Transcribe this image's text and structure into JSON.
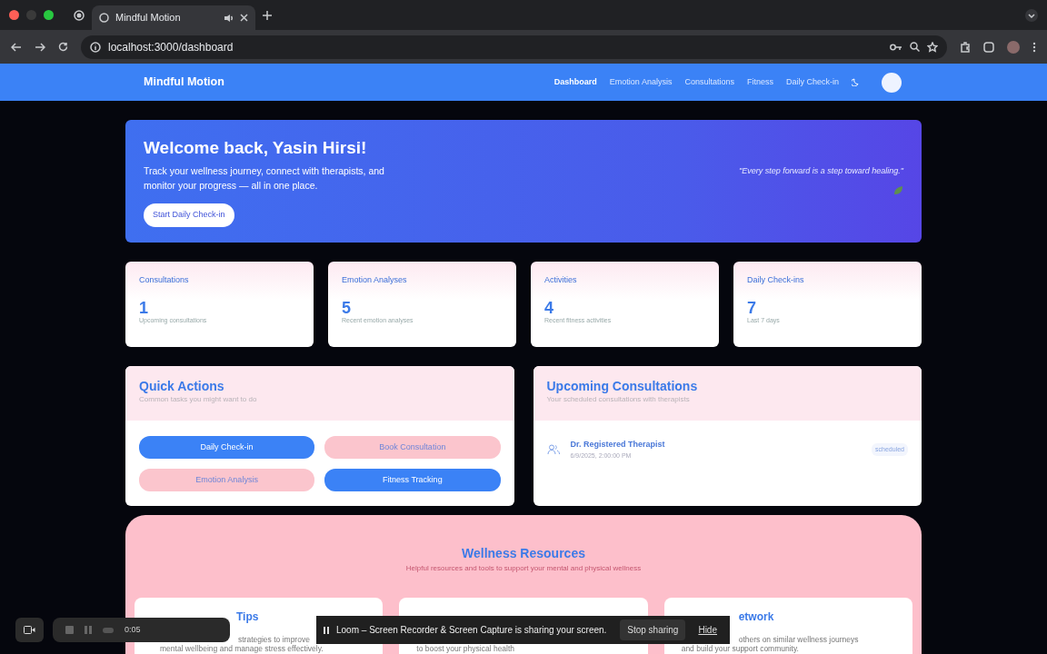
{
  "browser": {
    "tab_title": "Mindful Motion",
    "url": "localhost:3000/dashboard"
  },
  "navbar": {
    "brand": "Mindful Motion",
    "links": [
      {
        "label": "Dashboard",
        "selected": true
      },
      {
        "label": "Emotion Analysis",
        "selected": false
      },
      {
        "label": "Consultations",
        "selected": false
      },
      {
        "label": "Fitness",
        "selected": false
      },
      {
        "label": "Daily Check-in",
        "selected": false
      }
    ]
  },
  "hero": {
    "title": "Welcome back, Yasin Hirsi!",
    "subtitle": "Track your wellness journey, connect with therapists, and monitor your progress — all in one place.",
    "button": "Start Daily Check-in",
    "quote": "\"Every step forward is a step toward healing.\""
  },
  "stats": [
    {
      "label": "Consultations",
      "value": "1",
      "caption": "Upcoming consultations"
    },
    {
      "label": "Emotion Analyses",
      "value": "5",
      "caption": "Recent emotion analyses"
    },
    {
      "label": "Activities",
      "value": "4",
      "caption": "Recent fitness activities"
    },
    {
      "label": "Daily Check-ins",
      "value": "7",
      "caption": "Last 7 days"
    }
  ],
  "quick_actions": {
    "title": "Quick Actions",
    "subtitle": "Common tasks you might want to do",
    "buttons": [
      {
        "label": "Daily Check-in",
        "kind": "primary"
      },
      {
        "label": "Book Consultation",
        "kind": "soft"
      },
      {
        "label": "Emotion Analysis",
        "kind": "soft"
      },
      {
        "label": "Fitness Tracking",
        "kind": "primary"
      }
    ]
  },
  "upcoming": {
    "title": "Upcoming Consultations",
    "subtitle": "Your scheduled consultations with therapists",
    "items": [
      {
        "name": "Dr. Registered Therapist",
        "time": "6/9/2025, 2:00:00 PM",
        "status": "scheduled"
      }
    ]
  },
  "resources": {
    "title": "Wellness Resources",
    "subtitle": "Helpful resources and tools to support your mental and physical wellness",
    "cards": [
      {
        "title": "Tips",
        "lines": [
          "strategies to improve",
          "mental wellbeing and manage stress effectively."
        ]
      },
      {
        "lines": [
          "to boost your physical health"
        ]
      },
      {
        "title": "etwork",
        "lines": [
          "others on similar wellness journeys",
          "and build your support community."
        ]
      }
    ]
  },
  "screen_share": {
    "message": "Loom – Screen Recorder & Screen Capture is sharing your screen.",
    "stop": "Stop sharing",
    "hide": "Hide"
  },
  "recorder": {
    "time": "0:05"
  }
}
